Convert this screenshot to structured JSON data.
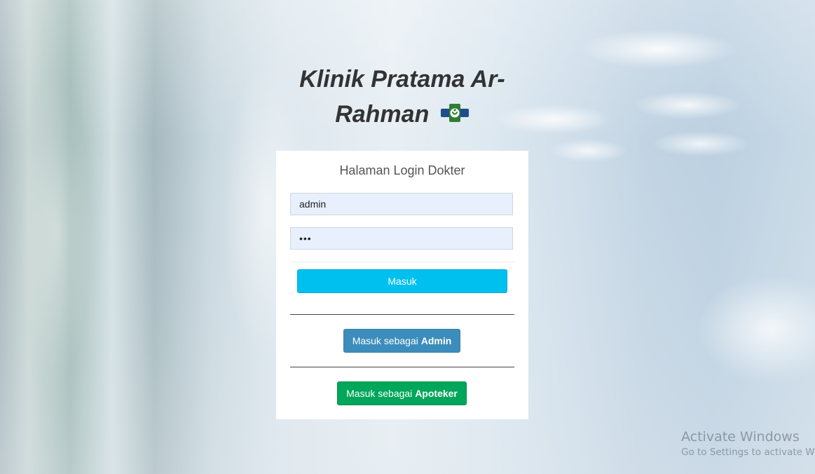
{
  "app": {
    "title": "Klinik Pratama Ar-Rahman",
    "logo_icon": "medical-cross-logo-icon"
  },
  "login": {
    "heading": "Halaman Login Dokter",
    "username_value": "admin",
    "password_value": "•••",
    "submit_label": "Masuk"
  },
  "alt_logins": {
    "admin": {
      "prefix": "Masuk sebagai ",
      "role": "Admin",
      "color": "#3c8dbc"
    },
    "apoteker": {
      "prefix": "Masuk sebagai ",
      "role": "Apoteker",
      "color": "#00a65a"
    }
  },
  "colors": {
    "primary_button": "#00c0ef",
    "card_background": "#ffffff",
    "input_background": "#e8f0fe"
  },
  "watermark": {
    "line1": "Activate Windows",
    "line2": "Go to Settings to activate Windows."
  }
}
